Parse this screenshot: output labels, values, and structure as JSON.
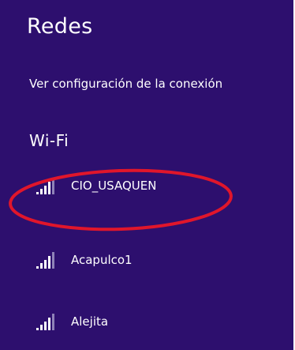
{
  "panel": {
    "title": "Redes",
    "connection_settings_link": "Ver configuración de la conexión",
    "section_title": "Wi-Fi",
    "networks": [
      {
        "name": "CIO_USAQUEN",
        "icon": "wifi-signal-icon",
        "signal_bars": 4
      },
      {
        "name": "Acapulco1",
        "icon": "wifi-signal-icon",
        "signal_bars": 4
      },
      {
        "name": "Alejita",
        "icon": "wifi-signal-icon",
        "signal_bars": 4
      }
    ]
  },
  "colors": {
    "background": "#2d0f6e",
    "text": "#ffffff",
    "annotation": "#e0162b"
  }
}
